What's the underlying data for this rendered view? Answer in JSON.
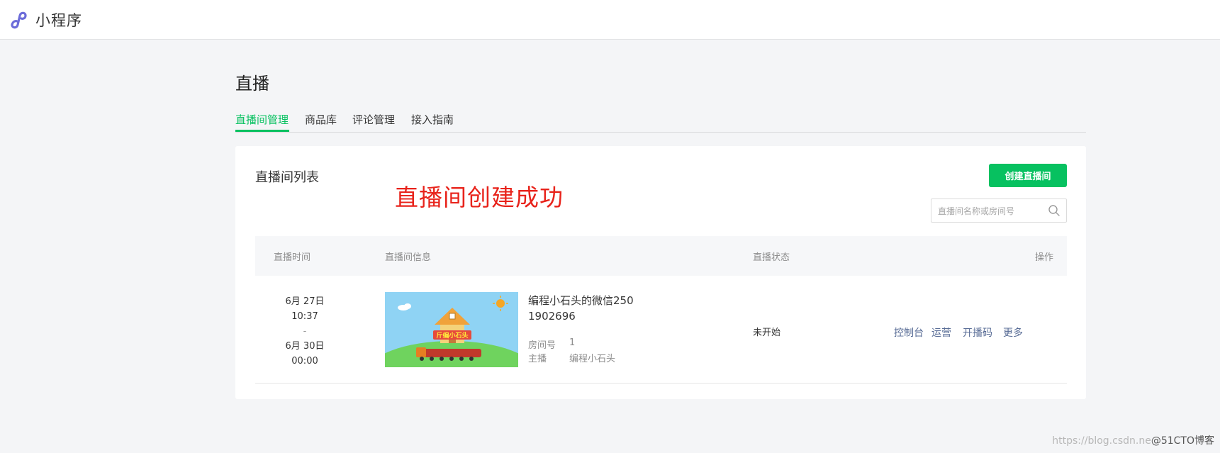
{
  "header": {
    "app_title": "小程序",
    "logo_icon": "mini-program-logo-icon"
  },
  "page": {
    "title": "直播"
  },
  "tabs": [
    {
      "label": "直播间管理",
      "active": true
    },
    {
      "label": "商品库",
      "active": false
    },
    {
      "label": "评论管理",
      "active": false
    },
    {
      "label": "接入指南",
      "active": false
    }
  ],
  "card": {
    "title": "直播间列表",
    "overlay_note": "直播间创建成功",
    "create_button": "创建直播间",
    "search_placeholder": "直播间名称或房间号",
    "search_icon": "search-icon"
  },
  "table": {
    "headers": {
      "time": "直播时间",
      "info": "直播间信息",
      "status": "直播状态",
      "actions": "操作"
    },
    "rows": [
      {
        "start_date": "6月 27日",
        "start_time": "10:37",
        "separator": "-",
        "end_date": "6月 30日",
        "end_time": "00:00",
        "cover_caption": "斤编小石头",
        "name": "编程小石头的微信250",
        "room_number_big": "1902696",
        "room_label": "房间号",
        "room_value": "1",
        "host_label": "主播",
        "host_value": "编程小石头",
        "status": "未开始",
        "actions": [
          "控制台",
          "运营",
          "开播码",
          "更多"
        ]
      }
    ]
  },
  "watermark": {
    "light": "https://blog.csdn.ne",
    "dark": "@51CTO博客"
  },
  "colors": {
    "brand_green": "#07c160",
    "link_blue": "#576b95",
    "annotation_red": "#e8231b"
  }
}
